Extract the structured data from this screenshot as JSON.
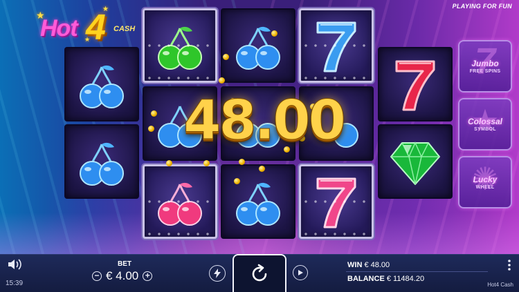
{
  "header": {
    "logo_hot": "Hot",
    "logo_four": "4",
    "logo_cash": "CASH",
    "mode_label": "PLAYING FOR FUN"
  },
  "win_display": "48.00",
  "features": [
    {
      "title": "Jumbo",
      "subtitle": "FREE SPINS",
      "icon": "seven-icon"
    },
    {
      "title": "Colossal",
      "subtitle": "SYMBOL",
      "icon": "star-icon"
    },
    {
      "title": "Lucky",
      "subtitle": "WHEEL",
      "icon": "wheel-icon"
    }
  ],
  "reels": [
    [
      "blue-cherry",
      "blue-cherry"
    ],
    [
      "green-cherry",
      "blue-cherry",
      "pink-cherry"
    ],
    [
      "blue-cherry",
      "blue-cherry",
      "blue-cherry"
    ],
    [
      "blue-seven",
      "blue-cherry",
      "pink-seven"
    ],
    [
      "red-seven",
      "green-gem"
    ]
  ],
  "bottom_bar": {
    "time": "15:39",
    "bet_label": "BET",
    "bet_value": "€ 4.00",
    "win_label": "WIN",
    "win_value": "€ 48.00",
    "balance_label": "BALANCE",
    "balance_value": "€ 11484.20",
    "game_name": "Hot4 Cash"
  },
  "colors": {
    "accent_gold": "#ffd24a",
    "neon_pink": "#ff5bd8",
    "bar_bg": "#141c40"
  }
}
